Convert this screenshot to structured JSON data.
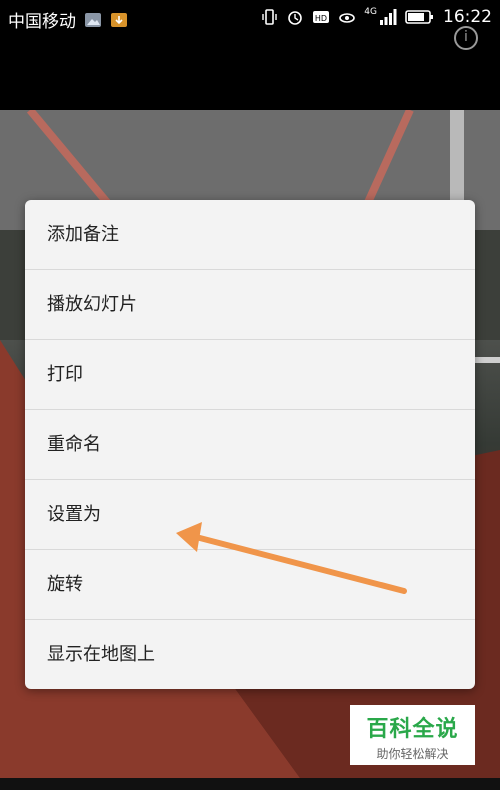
{
  "status": {
    "carrier": "中国移动",
    "network": "4G",
    "time": "16:22"
  },
  "menu": {
    "items": [
      {
        "label": "添加备注"
      },
      {
        "label": "播放幻灯片"
      },
      {
        "label": "打印"
      },
      {
        "label": "重命名"
      },
      {
        "label": "设置为"
      },
      {
        "label": "旋转"
      },
      {
        "label": "显示在地图上"
      }
    ]
  },
  "watermark": {
    "title": "百科全说",
    "subtitle": "助你轻松解决"
  },
  "colors": {
    "arrow": "#f0954a",
    "watermark_green": "#2aa84a"
  }
}
